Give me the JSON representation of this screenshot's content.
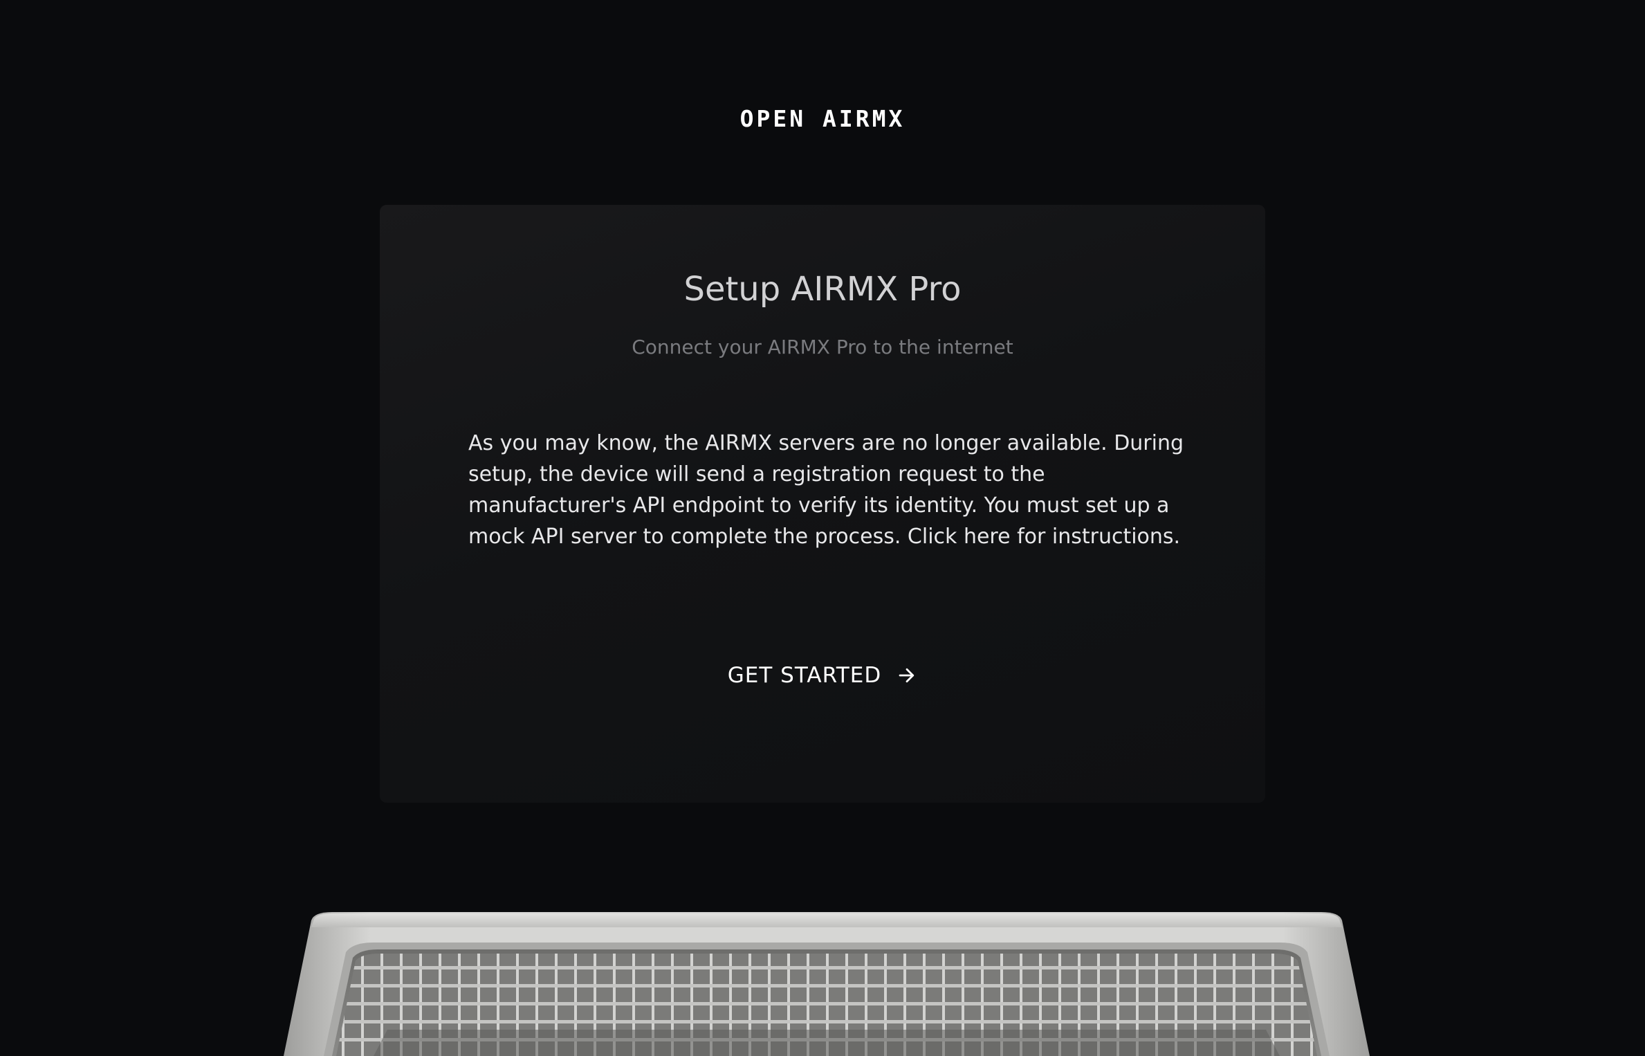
{
  "header": {
    "brand": "OPEN AIRMX"
  },
  "setup_card": {
    "title": "Setup AIRMX Pro",
    "subtitle": "Connect your AIRMX Pro to the internet",
    "body": "As you may know, the AIRMX servers are no longer available. During setup, the device will send a registration request to the manufacturer's API endpoint to verify its identity. You must set up a mock API server to complete the process. Click here for instructions.",
    "cta_label": "GET STARTED",
    "cta_icon": "arrow-right-icon"
  },
  "colors": {
    "background": "#0a0b0d",
    "card": "#151618",
    "text_primary": "#ffffff",
    "text_muted": "#7a7b7f"
  }
}
